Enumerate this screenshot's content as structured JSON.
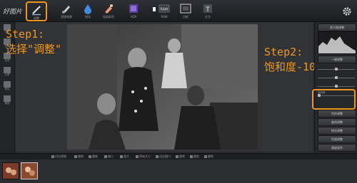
{
  "app": {
    "logo_text": "好图片"
  },
  "toolbar": {
    "tools": [
      {
        "label": "调整"
      },
      {
        "label": "滤镜效果"
      },
      {
        "label": "锐化"
      },
      {
        "label": "局部彩色"
      },
      {
        "label": "HDR"
      },
      {
        "label": "RAW"
      },
      {
        "label": "边框"
      },
      {
        "label": "文字"
      }
    ],
    "active_tool": "调整"
  },
  "annotations": {
    "step1_line1": "Step1:",
    "step1_line2": "选择\"调整\"",
    "step2_line1": "Step2:",
    "step2_line2": "饱和度-100"
  },
  "left_sidebar": {
    "items": [
      {
        "label": "打开"
      },
      {
        "label": "保存"
      },
      {
        "label": "另存"
      },
      {
        "label": "分享"
      },
      {
        "label": "导出"
      },
      {
        "label": "撤销"
      }
    ]
  },
  "right_panel": {
    "top_button": "直方图调整",
    "auto_button": "一键调整",
    "saturation_label": "饱和度",
    "saturation_value": -100,
    "buttons": [
      "色阶调整",
      "曲线调整",
      "锐化调整",
      "色相调整",
      "通道混合",
      "暗角效果"
    ]
  },
  "statusbar": {
    "items": [
      "对比原图",
      "撤销",
      "重做",
      "缩小",
      "放大",
      "原始大小",
      "适应窗口",
      "旋转",
      "裁剪",
      "翻转"
    ]
  },
  "filmstrip": {
    "thumb_count": 2,
    "selected_index": 1
  },
  "colors": {
    "accent": "#f0961e",
    "background": "#2a2b2e"
  }
}
